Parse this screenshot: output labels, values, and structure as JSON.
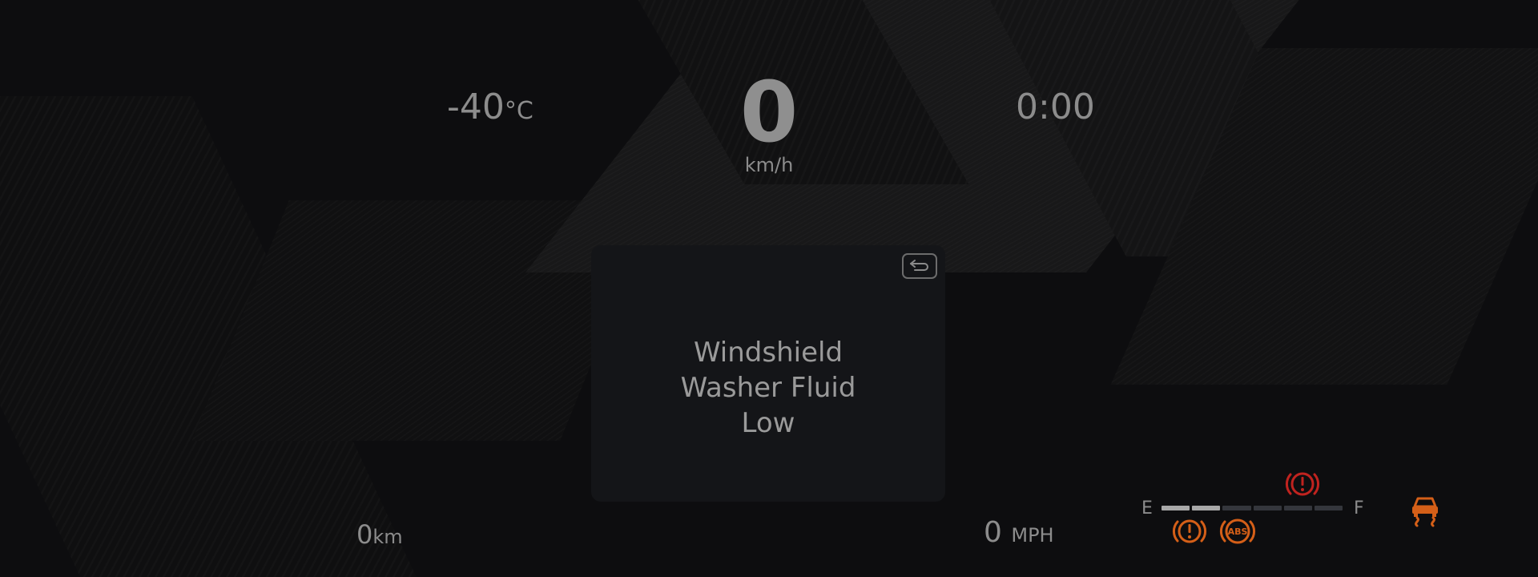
{
  "cluster": {
    "outside_temp": {
      "value": "-40",
      "unit": "°C"
    },
    "speed": {
      "value": "0",
      "unit": "km/h"
    },
    "clock": "0:00",
    "odometer": {
      "value": "0",
      "unit": "km"
    },
    "speed_mph": {
      "value": "0",
      "unit": "MPH"
    }
  },
  "alert_card": {
    "lines": [
      "Windshield",
      "Washer Fluid",
      "Low"
    ],
    "back_icon": "back-arrow-icon"
  },
  "fuel_gauge": {
    "empty_label": "E",
    "full_label": "F",
    "segments": 6,
    "level_fraction": 0.33
  },
  "indicators": [
    {
      "name": "brake-warning-icon",
      "color": "#c0231f"
    },
    {
      "name": "tire-pressure-warning-icon",
      "color": "#d45f18"
    },
    {
      "name": "abs-warning-icon",
      "color": "#d45f18",
      "label": "ABS"
    },
    {
      "name": "traction-control-icon",
      "color": "#d45f18"
    }
  ]
}
